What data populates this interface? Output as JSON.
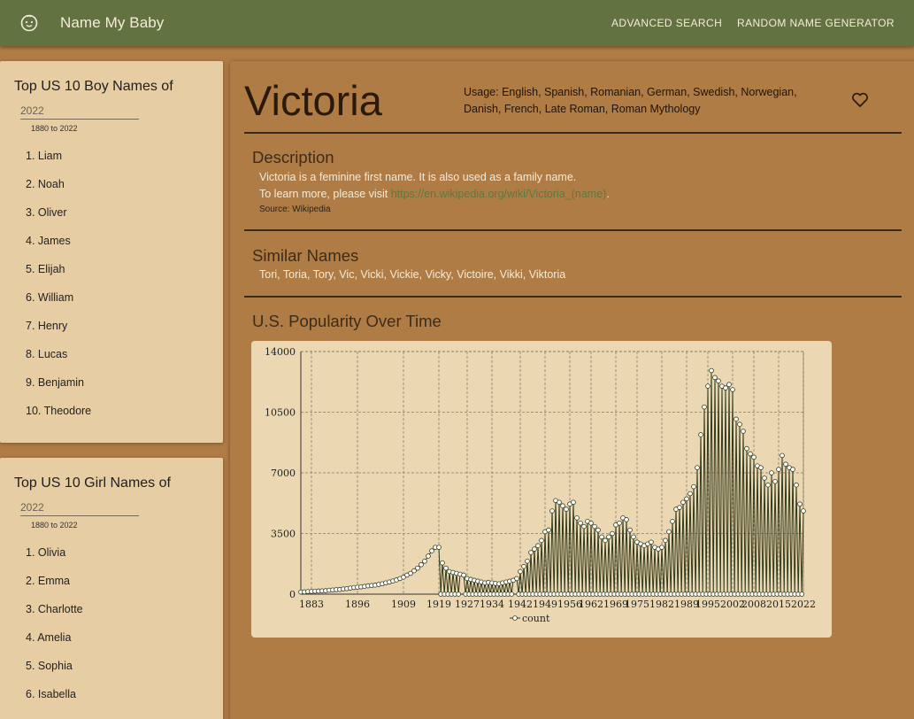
{
  "app": {
    "brand": "Name My Baby",
    "logo_icon": "baby-face-icon",
    "nav": [
      "ADVANCED SEARCH",
      "RANDOM NAME GENERATOR"
    ]
  },
  "boys": {
    "title": "Top US 10 Boy Names of",
    "year": "2022",
    "range": "1880 to 2022",
    "items": [
      "1. Liam",
      "2. Noah",
      "3. Oliver",
      "4. James",
      "5. Elijah",
      "6. William",
      "7. Henry",
      "8. Lucas",
      "9. Benjamin",
      "10. Theodore"
    ]
  },
  "girls": {
    "title": "Top US 10 Girl Names of",
    "year": "2022",
    "range": "1880 to 2022",
    "items": [
      "1. Olivia",
      "2. Emma",
      "3. Charlotte",
      "4. Amelia",
      "5. Sophia",
      "6. Isabella"
    ]
  },
  "name": {
    "title": "Victoria",
    "usage": "Usage: English, Spanish, Romanian, German, Swedish, Norwegian, Danish, French, Late Roman, Roman Mythology",
    "favorite_icon": "heart-outline-icon"
  },
  "description": {
    "heading": "Description",
    "line1": "Victoria is a feminine first name. It is also used as a family name.",
    "line2_prefix": "To learn more, please visit ",
    "link": "https://en.wikipedia.org/wiki/Victoria_(name)",
    "line2_suffix": ".",
    "source": "Source: Wikipedia"
  },
  "similar": {
    "heading": "Similar Names",
    "names": "Tori, Toria, Tory, Vic, Vicki, Vickie, Vicky, Victoire, Vikki, Viktoria"
  },
  "popularity": {
    "heading": "U.S. Popularity Over Time"
  },
  "chart_data": {
    "type": "line",
    "series_name": "count",
    "x_ticks": [
      "1883",
      "1896",
      "1909",
      "1919",
      "1927",
      "1934",
      "1942",
      "1949",
      "1956",
      "1962",
      "1969",
      "1975",
      "1982",
      "1989",
      "1995",
      "2002",
      "2008",
      "2015",
      "2022"
    ],
    "y_ticks": [
      "0",
      "3500",
      "7000",
      "10500",
      "14000"
    ],
    "ylim": [
      0,
      14000
    ],
    "xlim": [
      1880,
      2022
    ],
    "grid": true,
    "legend": "bottom",
    "line_color": "#2e3a1c",
    "zero_marker_years": [
      1920,
      1921,
      1922,
      1923,
      1924,
      1925,
      1927,
      1928,
      1929,
      1930,
      1931,
      1932,
      1933,
      1934,
      1935,
      1936,
      1937,
      1938,
      1939,
      1940,
      1942,
      1943,
      1944,
      1945,
      1946,
      1947,
      1948,
      1949,
      1950,
      1951,
      1952,
      1953,
      1954,
      1955,
      1956,
      1957,
      1958,
      1959,
      1960,
      1961,
      1962,
      1963,
      1964,
      1965,
      1966,
      1967,
      1968,
      1969,
      1970,
      1971,
      1972,
      1973,
      1974,
      1975,
      1976,
      1977,
      1978,
      1979,
      1980,
      1981,
      1982,
      1983,
      1984,
      1985,
      1986,
      1987,
      1988,
      1989,
      1990,
      1991,
      1992,
      1993,
      1994,
      1995,
      1996,
      1997,
      1998,
      1999,
      2000,
      2001,
      2002,
      2003,
      2004,
      2005,
      2006,
      2007,
      2008,
      2009,
      2010,
      2011,
      2012,
      2013,
      2014,
      2015,
      2016,
      2017,
      2018,
      2019,
      2020,
      2021,
      2022
    ],
    "points": [
      [
        1880,
        120
      ],
      [
        1881,
        130
      ],
      [
        1882,
        150
      ],
      [
        1883,
        160
      ],
      [
        1884,
        170
      ],
      [
        1885,
        180
      ],
      [
        1886,
        190
      ],
      [
        1887,
        200
      ],
      [
        1888,
        230
      ],
      [
        1889,
        240
      ],
      [
        1890,
        260
      ],
      [
        1891,
        270
      ],
      [
        1892,
        300
      ],
      [
        1893,
        320
      ],
      [
        1894,
        350
      ],
      [
        1895,
        380
      ],
      [
        1896,
        400
      ],
      [
        1897,
        420
      ],
      [
        1898,
        450
      ],
      [
        1899,
        480
      ],
      [
        1900,
        500
      ],
      [
        1901,
        520
      ],
      [
        1902,
        560
      ],
      [
        1903,
        600
      ],
      [
        1904,
        650
      ],
      [
        1905,
        700
      ],
      [
        1906,
        760
      ],
      [
        1907,
        820
      ],
      [
        1908,
        900
      ],
      [
        1909,
        980
      ],
      [
        1910,
        1100
      ],
      [
        1911,
        1200
      ],
      [
        1912,
        1350
      ],
      [
        1913,
        1500
      ],
      [
        1914,
        1700
      ],
      [
        1915,
        1900
      ],
      [
        1916,
        2200
      ],
      [
        1917,
        2500
      ],
      [
        1918,
        2700
      ],
      [
        1919,
        2700
      ],
      [
        1920,
        1800
      ],
      [
        1921,
        1500
      ],
      [
        1922,
        1300
      ],
      [
        1923,
        1250
      ],
      [
        1924,
        1200
      ],
      [
        1925,
        1150
      ],
      [
        1926,
        1100
      ],
      [
        1927,
        900
      ],
      [
        1928,
        850
      ],
      [
        1929,
        800
      ],
      [
        1930,
        750
      ],
      [
        1931,
        700
      ],
      [
        1932,
        650
      ],
      [
        1933,
        680
      ],
      [
        1934,
        650
      ],
      [
        1935,
        620
      ],
      [
        1936,
        600
      ],
      [
        1937,
        650
      ],
      [
        1938,
        700
      ],
      [
        1939,
        750
      ],
      [
        1940,
        800
      ],
      [
        1941,
        900
      ],
      [
        1942,
        1300
      ],
      [
        1943,
        1600
      ],
      [
        1944,
        1900
      ],
      [
        1945,
        2400
      ],
      [
        1946,
        2600
      ],
      [
        1947,
        2800
      ],
      [
        1948,
        3100
      ],
      [
        1949,
        3600
      ],
      [
        1950,
        3700
      ],
      [
        1951,
        4800
      ],
      [
        1952,
        5400
      ],
      [
        1953,
        5300
      ],
      [
        1954,
        5100
      ],
      [
        1955,
        4900
      ],
      [
        1956,
        5200
      ],
      [
        1957,
        5300
      ],
      [
        1958,
        4400
      ],
      [
        1959,
        4100
      ],
      [
        1960,
        3900
      ],
      [
        1961,
        4200
      ],
      [
        1962,
        4100
      ],
      [
        1963,
        3900
      ],
      [
        1964,
        3700
      ],
      [
        1965,
        3300
      ],
      [
        1966,
        3100
      ],
      [
        1967,
        3300
      ],
      [
        1968,
        3500
      ],
      [
        1969,
        4000
      ],
      [
        1970,
        4100
      ],
      [
        1971,
        4400
      ],
      [
        1972,
        4300
      ],
      [
        1973,
        3700
      ],
      [
        1974,
        3300
      ],
      [
        1975,
        3000
      ],
      [
        1976,
        2900
      ],
      [
        1977,
        2800
      ],
      [
        1978,
        2900
      ],
      [
        1979,
        3000
      ],
      [
        1980,
        2700
      ],
      [
        1981,
        2600
      ],
      [
        1982,
        2700
      ],
      [
        1983,
        3100
      ],
      [
        1984,
        3600
      ],
      [
        1985,
        4200
      ],
      [
        1986,
        4900
      ],
      [
        1987,
        5000
      ],
      [
        1988,
        5300
      ],
      [
        1989,
        5500
      ],
      [
        1990,
        5800
      ],
      [
        1991,
        6200
      ],
      [
        1992,
        7300
      ],
      [
        1993,
        9200
      ],
      [
        1994,
        10800
      ],
      [
        1995,
        12000
      ],
      [
        1996,
        12900
      ],
      [
        1997,
        12500
      ],
      [
        1998,
        12300
      ],
      [
        1999,
        12000
      ],
      [
        2000,
        11900
      ],
      [
        2001,
        12100
      ],
      [
        2002,
        11800
      ],
      [
        2003,
        10100
      ],
      [
        2004,
        9800
      ],
      [
        2005,
        9400
      ],
      [
        2006,
        8400
      ],
      [
        2007,
        8100
      ],
      [
        2008,
        7900
      ],
      [
        2009,
        7400
      ],
      [
        2010,
        7300
      ],
      [
        2011,
        6700
      ],
      [
        2012,
        6300
      ],
      [
        2013,
        7000
      ],
      [
        2014,
        6500
      ],
      [
        2015,
        7200
      ],
      [
        2016,
        8000
      ],
      [
        2017,
        7500
      ],
      [
        2018,
        7300
      ],
      [
        2019,
        7200
      ],
      [
        2020,
        6300
      ],
      [
        2021,
        5200
      ],
      [
        2022,
        4800
      ]
    ]
  }
}
